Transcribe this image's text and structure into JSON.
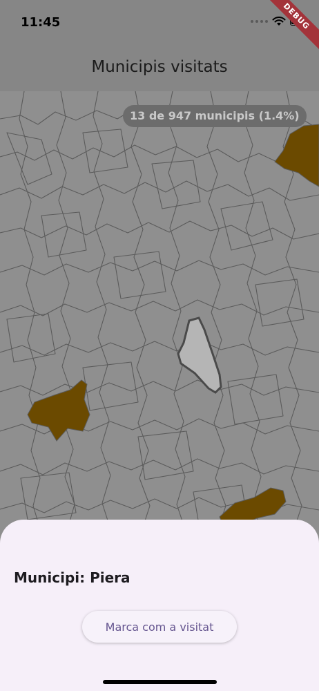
{
  "status_bar": {
    "time": "11:45",
    "icons": [
      "signal-dots-icon",
      "wifi-icon",
      "battery-icon"
    ]
  },
  "debug_banner": "DEBUG",
  "app_bar": {
    "title": "Municipis visitats"
  },
  "map": {
    "counter": "13 de 947 municipis (1.4%)",
    "visited_color": "#6b4a00",
    "selected_color": "#b5b5b5",
    "border_color": "#5b5b5b",
    "background_color": "#8f8f8f",
    "visited_count": 13,
    "total_count": 947
  },
  "bottom_sheet": {
    "municipality": "Municipi: Piera",
    "mark_button_label": "Marca com a visitat",
    "background_color": "#f6eff9",
    "button_text_color": "#65558f"
  }
}
